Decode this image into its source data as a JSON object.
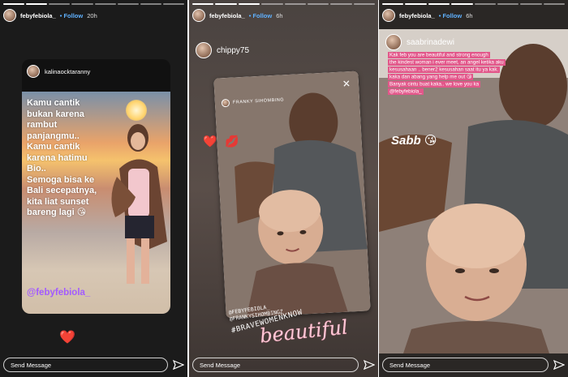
{
  "panels": [
    {
      "username": "febyfebiola_",
      "follow": "• Follow",
      "time": "20h",
      "more": "•••",
      "send_message": "Send Message",
      "card_user": "kalinaocktaranny",
      "story_lines": [
        "Kamu cantik",
        "bukan karena",
        "rambut",
        "panjangmu..",
        "Kamu cantik",
        "karena hatimu",
        "Bio..",
        "Semoga bisa ke",
        "Bali secepatnya,",
        "kita liat sunset",
        "bareng lagi 😘"
      ],
      "mention": "@febyfebiola_",
      "heart": "❤️"
    },
    {
      "username": "febyfebiola_",
      "follow": "• Follow",
      "time": "6h",
      "more": "•••",
      "send_message": "Send Message",
      "card_user": "chippy75",
      "reshare_user": "FRANKY SIHOMBING",
      "reshare_close": "✕",
      "stickers": [
        "❤️",
        "💋"
      ],
      "tags": [
        "@FEBYFEBIOLA_",
        "@FRANKYSIHOMBINGZ"
      ],
      "hashtag": "#BRAVEWOMENKNOW",
      "beautiful": "beautiful"
    },
    {
      "username": "febyfebiola_",
      "follow": "• Follow",
      "time": "6h",
      "more": "•••",
      "send_message": "Send Message",
      "card_user": "saabrinadewi",
      "message_lines": [
        "Kak feb you are beautiful and strong enough",
        "the kindest woman i ever meet, an angel ketika aku",
        "kesusahaan .. bener2 kesusahan saat itu ya kak.",
        "kaka dan abang yang help me out 😘",
        "Banyak cintu buat kaka.. we love you ka",
        "@febyfebiola_"
      ],
      "sabb": "Sabb",
      "sabb_emoji": "😘"
    }
  ],
  "colors": {
    "follow": "#5fb1ff",
    "mention": "#a35bff",
    "pink_box": "#e2578a"
  },
  "icons": {
    "send": "paper-plane-icon",
    "more": "more-dots-icon",
    "close": "close-icon"
  }
}
